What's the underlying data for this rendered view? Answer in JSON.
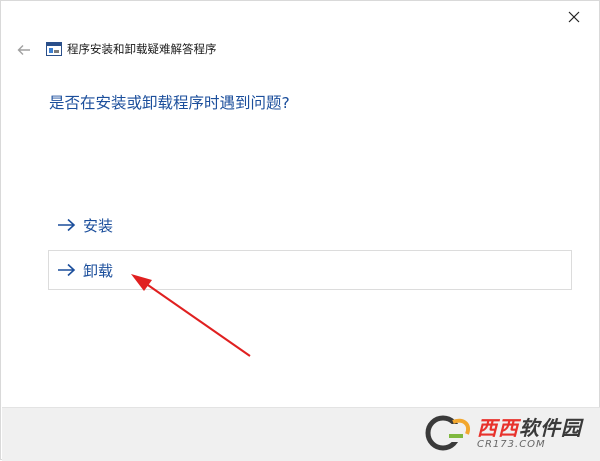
{
  "window": {
    "title": "程序安装和卸载疑难解答程序",
    "heading": "是否在安装或卸载程序时遇到问题?"
  },
  "options": [
    {
      "label": "安装"
    },
    {
      "label": "卸载"
    }
  ],
  "watermark": {
    "main_a": "西西",
    "main_b": "软件园",
    "sub": "CR173.COM"
  },
  "colors": {
    "accent": "#1c4f9c",
    "annotation_arrow": "#e02020",
    "footer_bg": "#f0f0f0"
  }
}
